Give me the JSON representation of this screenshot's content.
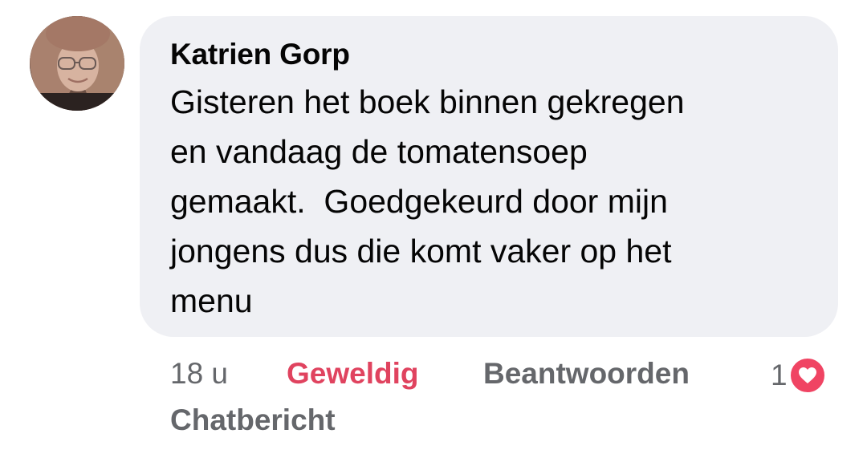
{
  "comment": {
    "author": "Katrien Gorp",
    "text": "Gisteren het boek binnen gekregen\nen vandaag de tomatensoep\ngemaakt.  Goedgekeurd door mijn\njongens dus die komt vaker op het\nmenu"
  },
  "actions": {
    "time": "18 u",
    "reaction_label": "Geweldig",
    "reply_label": "Beantwoorden",
    "reaction_count": "1",
    "message_label": "Chatbericht"
  },
  "icons": {
    "reaction": "heart-icon",
    "avatar": "profile-photo"
  },
  "colors": {
    "bubble": "#eff0f4",
    "reaction": "#e0435f",
    "heart": "#f04463",
    "secondary_text": "#65676b"
  }
}
